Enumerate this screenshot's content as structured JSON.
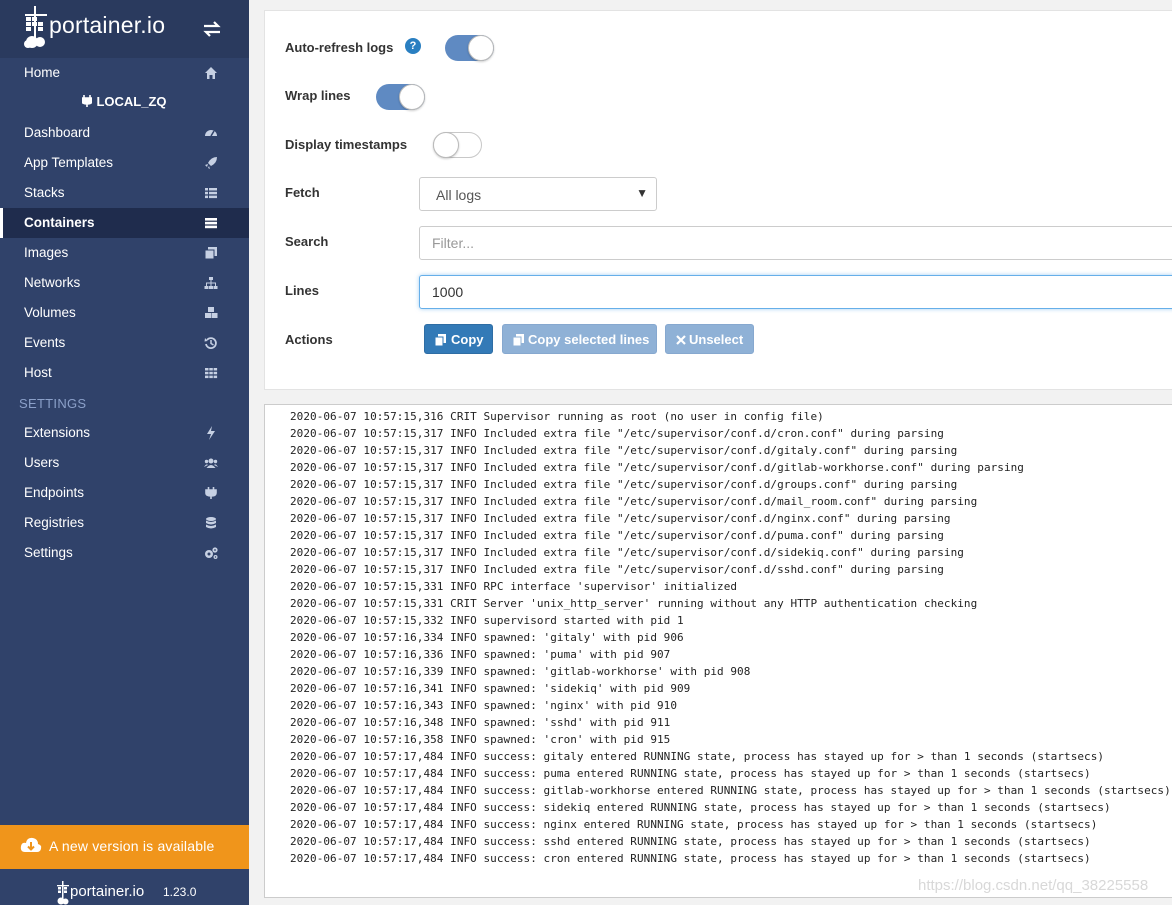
{
  "brand": {
    "name": "portainer.io",
    "toggle_icon": "exchange-icon"
  },
  "sidebar": {
    "home": "Home",
    "environment": "LOCAL_ZQ",
    "items": [
      {
        "label": "Dashboard",
        "icon": "tachometer-icon"
      },
      {
        "label": "App Templates",
        "icon": "rocket-icon"
      },
      {
        "label": "Stacks",
        "icon": "th-list-icon"
      },
      {
        "label": "Containers",
        "icon": "server-icon",
        "active": true
      },
      {
        "label": "Images",
        "icon": "clone-icon"
      },
      {
        "label": "Networks",
        "icon": "sitemap-icon"
      },
      {
        "label": "Volumes",
        "icon": "cubes-icon"
      },
      {
        "label": "Events",
        "icon": "history-icon"
      },
      {
        "label": "Host",
        "icon": "th-icon"
      }
    ],
    "settings_title": "SETTINGS",
    "settings_items": [
      {
        "label": "Extensions",
        "icon": "bolt-icon"
      },
      {
        "label": "Users",
        "icon": "users-icon"
      },
      {
        "label": "Endpoints",
        "icon": "plug-icon"
      },
      {
        "label": "Registries",
        "icon": "database-icon"
      },
      {
        "label": "Settings",
        "icon": "cogs-icon"
      }
    ],
    "update_notice": "A new version is available",
    "footer_brand": "portainer.io",
    "version": "1.23.0"
  },
  "log_settings": {
    "auto_refresh_label": "Auto-refresh logs",
    "auto_refresh": true,
    "wrap_lines_label": "Wrap lines",
    "wrap_lines": true,
    "timestamps_label": "Display timestamps",
    "timestamps": false,
    "fetch_label": "Fetch",
    "fetch_value": "All logs",
    "search_label": "Search",
    "search_placeholder": "Filter...",
    "lines_label": "Lines",
    "lines_value": "1000",
    "actions_label": "Actions",
    "copy_label": "Copy",
    "copy_selected_label": "Copy selected lines",
    "unselect_label": "Unselect"
  },
  "logs": [
    "2020-06-07 10:57:15,316 CRIT Supervisor running as root (no user in config file)",
    "2020-06-07 10:57:15,317 INFO Included extra file \"/etc/supervisor/conf.d/cron.conf\" during parsing",
    "2020-06-07 10:57:15,317 INFO Included extra file \"/etc/supervisor/conf.d/gitaly.conf\" during parsing",
    "2020-06-07 10:57:15,317 INFO Included extra file \"/etc/supervisor/conf.d/gitlab-workhorse.conf\" during parsing",
    "2020-06-07 10:57:15,317 INFO Included extra file \"/etc/supervisor/conf.d/groups.conf\" during parsing",
    "2020-06-07 10:57:15,317 INFO Included extra file \"/etc/supervisor/conf.d/mail_room.conf\" during parsing",
    "2020-06-07 10:57:15,317 INFO Included extra file \"/etc/supervisor/conf.d/nginx.conf\" during parsing",
    "2020-06-07 10:57:15,317 INFO Included extra file \"/etc/supervisor/conf.d/puma.conf\" during parsing",
    "2020-06-07 10:57:15,317 INFO Included extra file \"/etc/supervisor/conf.d/sidekiq.conf\" during parsing",
    "2020-06-07 10:57:15,317 INFO Included extra file \"/etc/supervisor/conf.d/sshd.conf\" during parsing",
    "2020-06-07 10:57:15,331 INFO RPC interface 'supervisor' initialized",
    "2020-06-07 10:57:15,331 CRIT Server 'unix_http_server' running without any HTTP authentication checking",
    "2020-06-07 10:57:15,332 INFO supervisord started with pid 1",
    "2020-06-07 10:57:16,334 INFO spawned: 'gitaly' with pid 906",
    "2020-06-07 10:57:16,336 INFO spawned: 'puma' with pid 907",
    "2020-06-07 10:57:16,339 INFO spawned: 'gitlab-workhorse' with pid 908",
    "2020-06-07 10:57:16,341 INFO spawned: 'sidekiq' with pid 909",
    "2020-06-07 10:57:16,343 INFO spawned: 'nginx' with pid 910",
    "2020-06-07 10:57:16,348 INFO spawned: 'sshd' with pid 911",
    "2020-06-07 10:57:16,358 INFO spawned: 'cron' with pid 915",
    "2020-06-07 10:57:17,484 INFO success: gitaly entered RUNNING state, process has stayed up for > than 1 seconds (startsecs)",
    "2020-06-07 10:57:17,484 INFO success: puma entered RUNNING state, process has stayed up for > than 1 seconds (startsecs)",
    "2020-06-07 10:57:17,484 INFO success: gitlab-workhorse entered RUNNING state, process has stayed up for > than 1 seconds (startsecs)",
    "2020-06-07 10:57:17,484 INFO success: sidekiq entered RUNNING state, process has stayed up for > than 1 seconds (startsecs)",
    "2020-06-07 10:57:17,484 INFO success: nginx entered RUNNING state, process has stayed up for > than 1 seconds (startsecs)",
    "2020-06-07 10:57:17,484 INFO success: sshd entered RUNNING state, process has stayed up for > than 1 seconds (startsecs)",
    "2020-06-07 10:57:17,484 INFO success: cron entered RUNNING state, process has stayed up for > than 1 seconds (startsecs)"
  ],
  "watermark": "https://blog.csdn.net/qq_38225558"
}
